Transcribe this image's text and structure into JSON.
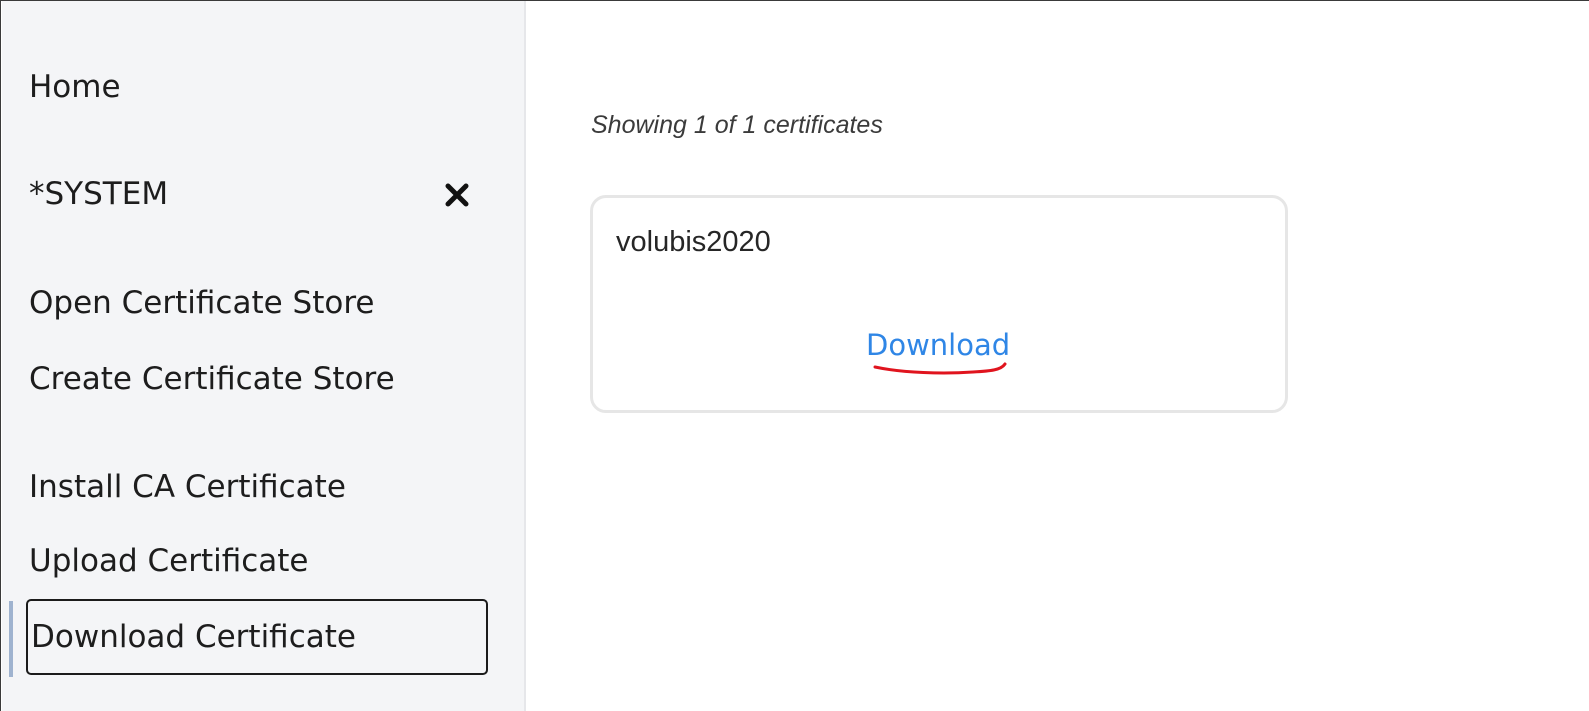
{
  "sidebar": {
    "home_label": "Home",
    "system_label": "*SYSTEM",
    "open_store_label": "Open Certificate Store",
    "create_store_label": "Create Certificate Store",
    "install_ca_label": "Install CA Certificate",
    "upload_label": "Upload Certificate",
    "download_label": "Download Certificate",
    "close_icon": "close-icon"
  },
  "main": {
    "count_text": "Showing 1 of 1 certificates",
    "certificates": [
      {
        "name": "volubis2020",
        "download_label": "Download"
      }
    ]
  },
  "colors": {
    "sidebar_bg": "#f4f5f7",
    "link": "#2f86e6",
    "annotation": "#e0141e"
  }
}
